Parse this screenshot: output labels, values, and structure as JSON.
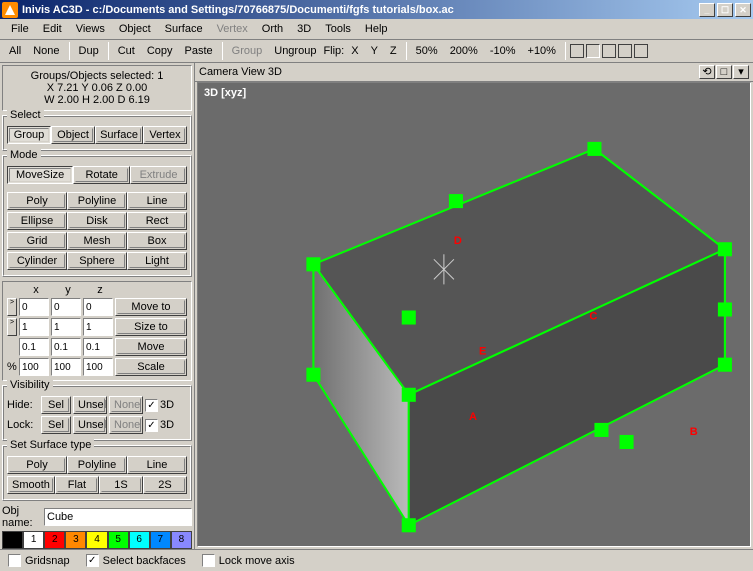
{
  "title": "Inivis AC3D - c:/Documents and Settings/70766875/Documenti/fgfs tutorials/box.ac",
  "menu": [
    "File",
    "Edit",
    "Views",
    "Object",
    "Surface",
    "Vertex",
    "Orth",
    "3D",
    "Tools",
    "Help"
  ],
  "menu_disabled": [
    5
  ],
  "info": {
    "sel": "Groups/Objects selected: 1",
    "pos": "X 7.21 Y 0.06 Z 0.00",
    "dim": "W 2.00 H 2.00 D 6.19"
  },
  "toolbar": {
    "all": "All",
    "none": "None",
    "dup": "Dup",
    "cut": "Cut",
    "copy": "Copy",
    "paste": "Paste",
    "group": "Group",
    "ungroup": "Ungroup",
    "flip": "Flip:",
    "x": "X",
    "y": "Y",
    "z": "Z",
    "p50": "50%",
    "p200": "200%",
    "m10": "-10%",
    "p10": "+10%"
  },
  "select": {
    "legend": "Select",
    "group": "Group",
    "object": "Object",
    "surface": "Surface",
    "vertex": "Vertex"
  },
  "mode": {
    "legend": "Mode",
    "movesize": "MoveSize",
    "rotate": "Rotate",
    "extrude": "Extrude",
    "poly": "Poly",
    "polyline": "Polyline",
    "line": "Line",
    "ellipse": "Ellipse",
    "disk": "Disk",
    "rect": "Rect",
    "grid": "Grid",
    "mesh": "Mesh",
    "box": "Box",
    "cylinder": "Cylinder",
    "sphere": "Sphere",
    "light": "Light"
  },
  "xyz": {
    "x": "x",
    "y": "y",
    "z": "z",
    "moveto_x": "0",
    "moveto_y": "0",
    "moveto_z": "0",
    "moveto": "Move to",
    "sizeto_x": "1",
    "sizeto_y": "1",
    "sizeto_z": "1",
    "sizeto": "Size to",
    "move_x": "0.1",
    "move_y": "0.1",
    "move_z": "0.1",
    "move": "Move",
    "scale_x": "100",
    "scale_y": "100",
    "scale_z": "100",
    "scale": "Scale",
    "pct": "%"
  },
  "vis": {
    "legend": "Visibility",
    "hide": "Hide:",
    "lock": "Lock:",
    "sel": "Sel",
    "unsel": "Unsel",
    "none": "None",
    "_3d": "3D"
  },
  "surf": {
    "legend": "Set Surface type",
    "poly": "Poly",
    "polyline": "Polyline",
    "line": "Line",
    "smooth": "Smooth",
    "flat": "Flat",
    "_1s": "1S",
    "_2s": "2S"
  },
  "obj": {
    "label": "Obj name:",
    "value": "Cube"
  },
  "palette": [
    {
      "n": "",
      "bg": "#000000",
      "fg": "#ffffff"
    },
    {
      "n": "1",
      "bg": "#ffffff",
      "fg": "#000000"
    },
    {
      "n": "2",
      "bg": "#ff0000",
      "fg": "#000000"
    },
    {
      "n": "3",
      "bg": "#ff8800",
      "fg": "#000000"
    },
    {
      "n": "4",
      "bg": "#ffff00",
      "fg": "#000000"
    },
    {
      "n": "5",
      "bg": "#00ff00",
      "fg": "#000000"
    },
    {
      "n": "6",
      "bg": "#00ffff",
      "fg": "#000000"
    },
    {
      "n": "7",
      "bg": "#0088ff",
      "fg": "#000000"
    },
    {
      "n": "8",
      "bg": "#8888ff",
      "fg": "#000000"
    }
  ],
  "view": {
    "title": "Camera  View  3D",
    "label": "3D [xyz]"
  },
  "annotations": {
    "a": "A",
    "b": "B",
    "c": "C",
    "d": "D",
    "e": "E"
  },
  "status": {
    "gridsnap": "Gridsnap",
    "backfaces": "Select backfaces",
    "lockmove": "Lock move axis"
  },
  "colors": {
    "sel": "#00ff00",
    "annot": "#ff0000",
    "canvas": "#6b6b6b"
  }
}
